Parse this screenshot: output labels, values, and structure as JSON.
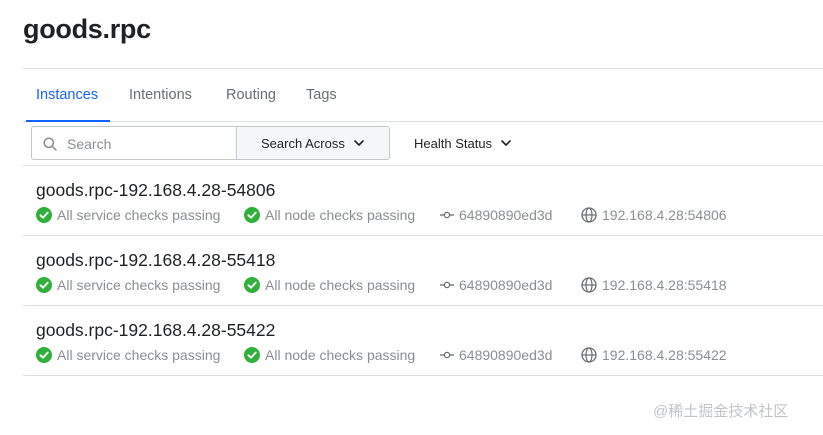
{
  "page": {
    "title": "goods.rpc"
  },
  "tabs": [
    {
      "label": "Instances",
      "active": true
    },
    {
      "label": "Intentions"
    },
    {
      "label": "Routing"
    },
    {
      "label": "Tags"
    }
  ],
  "filters": {
    "search_placeholder": "Search",
    "search_across_label": "Search Across",
    "health_status_label": "Health Status"
  },
  "instances": [
    {
      "name": "goods.rpc-192.168.4.28-54806",
      "service_checks": "All service checks passing",
      "node_checks": "All node checks passing",
      "commit": "64890890ed3d",
      "address": "192.168.4.28:54806"
    },
    {
      "name": "goods.rpc-192.168.4.28-55418",
      "service_checks": "All service checks passing",
      "node_checks": "All node checks passing",
      "commit": "64890890ed3d",
      "address": "192.168.4.28:55418"
    },
    {
      "name": "goods.rpc-192.168.4.28-55422",
      "service_checks": "All service checks passing",
      "node_checks": "All node checks passing",
      "commit": "64890890ed3d",
      "address": "192.168.4.28:55422"
    }
  ],
  "watermark": "@稀土掘金技术社区",
  "colors": {
    "accent": "#1563ff",
    "passing": "#2eb039",
    "muted_text": "#8b8e96",
    "border": "#dcdfe4"
  },
  "icons": {
    "search": "search-icon",
    "chevron": "chevron-down-icon",
    "passing": "check-circle-icon",
    "commit": "git-commit-icon",
    "address": "globe-icon"
  }
}
